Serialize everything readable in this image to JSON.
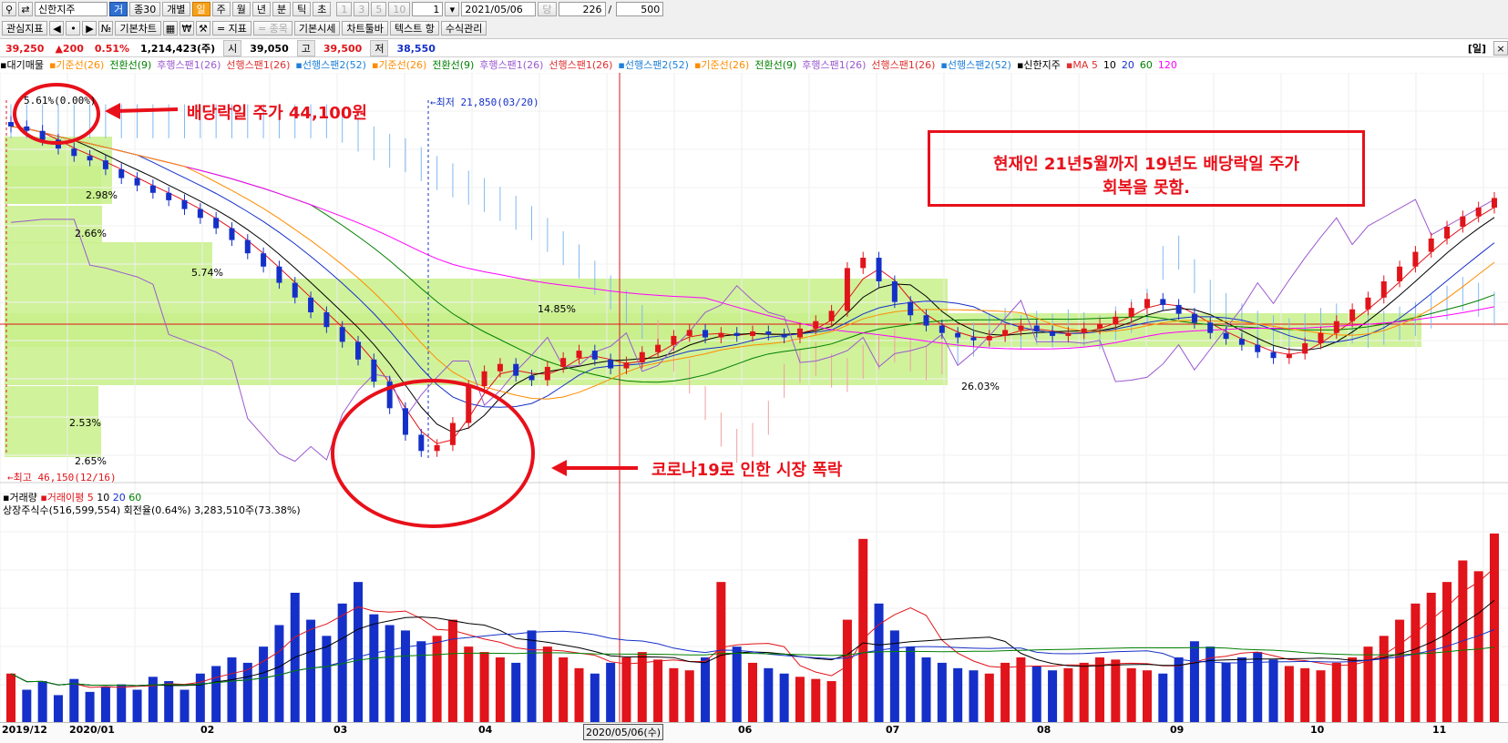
{
  "toolbar": {
    "stock_name": "신한지주",
    "geo_label": "거",
    "interval_label": "종30",
    "individual": "개별",
    "periods": [
      "일",
      "주",
      "월",
      "년",
      "분",
      "틱",
      "초"
    ],
    "active_period": "일",
    "minute_values": [
      "1",
      "3",
      "5",
      "10"
    ],
    "count_value": "1",
    "date_value": "2021/05/06",
    "dang_label": "당",
    "page_current": "226",
    "page_total": "500"
  },
  "toolbar2": {
    "watch_label": "관심지표",
    "basic_chart": "기본차트",
    "indicator": "= 지표",
    "item": "= 종목",
    "basic_quote": "기본시세",
    "chart_toolbar": "차트툴바",
    "text_label": "텍스트 항",
    "formula": "수식관리"
  },
  "quote": {
    "price": "39,250",
    "change": "▲200",
    "change_pct": "0.51%",
    "volume": "1,214,423(주)",
    "open_label": "시",
    "open": "39,050",
    "high_label": "고",
    "high": "39,500",
    "low_label": "저",
    "low": "38,550",
    "period_badge": "[일]"
  },
  "legend": {
    "items": [
      {
        "text": "▪대기매물",
        "color": "#000000"
      },
      {
        "text": "▪기준선(26)",
        "color": "#ff8c00"
      },
      {
        "text": "전환선(9)",
        "color": "#008000"
      },
      {
        "text": "후행스팬1(26)",
        "color": "#9b59d0"
      },
      {
        "text": "선행스팬1(26)",
        "color": "#e03030"
      },
      {
        "text": "▪선행스팬2(52)",
        "color": "#1e7fd8"
      },
      {
        "text": "▪기준선(26)",
        "color": "#ff8c00"
      },
      {
        "text": "전환선(9)",
        "color": "#008000"
      },
      {
        "text": "후행스팬1(26)",
        "color": "#9b59d0"
      },
      {
        "text": "선행스팬1(26)",
        "color": "#e03030"
      },
      {
        "text": "▪선행스팬2(52)",
        "color": "#1e7fd8"
      },
      {
        "text": "▪기준선(26)",
        "color": "#ff8c00"
      },
      {
        "text": "전환선(9)",
        "color": "#008000"
      },
      {
        "text": "후행스팬1(26)",
        "color": "#9b59d0"
      },
      {
        "text": "선행스팬1(26)",
        "color": "#e03030"
      },
      {
        "text": "▪선행스팬2(52)",
        "color": "#1e7fd8"
      },
      {
        "text": "▪신한지주",
        "color": "#000000"
      },
      {
        "text": "▪MA 5",
        "color": "#e03030"
      },
      {
        "text": "10",
        "color": "#000000"
      },
      {
        "text": "20",
        "color": "#1530c8"
      },
      {
        "text": "60",
        "color": "#008000"
      },
      {
        "text": "120",
        "color": "#ff00ff"
      }
    ]
  },
  "price_labels": {
    "high_marker": "←최고 46,150(12/16)",
    "low_marker": "←최저 21,850(03/20)",
    "top_pct": "5.61%(0.00%)"
  },
  "volume_profile": [
    {
      "pct": "2.98%"
    },
    {
      "pct": "2.66%"
    },
    {
      "pct": "5.74%"
    },
    {
      "pct": "14.85%"
    },
    {
      "pct": "26.03%"
    },
    {
      "pct": "2.53%"
    },
    {
      "pct": "2.65%"
    }
  ],
  "volume_legend": {
    "title": "▪거래량",
    "ma_label": "▪거래이평",
    "ma_values": [
      "5",
      "10",
      "20",
      "60"
    ],
    "info": "상장주식수(516,599,554) 회전율(0.64%) 3,283,510주(73.38%)"
  },
  "annotations": {
    "dividend": "배당락일 주가 44,100원",
    "recovery_line1": "현재인 21년5월까지 19년도 배당락일 주가",
    "recovery_line2": "회복을 못함.",
    "covid": "코로나19로 인한 시장 폭락"
  },
  "x_axis": {
    "labels": [
      "2019/12",
      "2020/01",
      "02",
      "03",
      "04",
      "2020/05/06(수)",
      "06",
      "07",
      "08",
      "09",
      "10",
      "11"
    ]
  },
  "colors": {
    "up": "#e0141a",
    "down": "#1530c8",
    "annotation": "#e8101a",
    "profile": "#c8f08a",
    "cloud_red": "#f0a0a0",
    "cloud_blue": "#80b8f0"
  },
  "chart_data": {
    "type": "candlestick",
    "price_series": [
      44100,
      43800,
      43200,
      42600,
      42100,
      41800,
      41200,
      40600,
      40100,
      39600,
      39100,
      38500,
      37900,
      37200,
      36400,
      35500,
      34600,
      33500,
      32500,
      31500,
      30500,
      29500,
      28300,
      26800,
      25000,
      23200,
      22100,
      22500,
      24000,
      26500,
      27500,
      28000,
      27200,
      26900,
      27800,
      28400,
      28900,
      28300,
      27700,
      28100,
      28800,
      29300,
      29900,
      30300,
      29800,
      30100,
      29900,
      30200,
      30000,
      29800,
      30400,
      30900,
      31600,
      34500,
      35200,
      33600,
      32200,
      31300,
      30600,
      30100,
      29800,
      29600,
      29900,
      30300,
      30600,
      30200,
      29900,
      30100,
      30400,
      30700,
      31200,
      31800,
      32400,
      32000,
      31400,
      30800,
      30100,
      29700,
      29300,
      28800,
      28400,
      28700,
      29400,
      30100,
      30900,
      31700,
      32500,
      33600,
      34600,
      35600,
      36500,
      37300,
      38000,
      38600,
      39250
    ],
    "volume_series": [
      45,
      30,
      38,
      25,
      40,
      28,
      33,
      35,
      30,
      42,
      38,
      30,
      45,
      52,
      60,
      55,
      70,
      90,
      120,
      95,
      80,
      110,
      130,
      100,
      90,
      85,
      75,
      80,
      95,
      70,
      65,
      60,
      55,
      85,
      70,
      60,
      50,
      45,
      55,
      60,
      65,
      58,
      50,
      48,
      60,
      130,
      70,
      55,
      50,
      45,
      42,
      40,
      38,
      95,
      170,
      110,
      85,
      70,
      60,
      55,
      50,
      48,
      45,
      55,
      60,
      52,
      48,
      50,
      55,
      60,
      58,
      50,
      48,
      45,
      60,
      75,
      70,
      55,
      60,
      65,
      58,
      52,
      50,
      48,
      55,
      60,
      70,
      80,
      95,
      110,
      120,
      130,
      150,
      140,
      175
    ],
    "notes": "relative daily values read visually"
  }
}
